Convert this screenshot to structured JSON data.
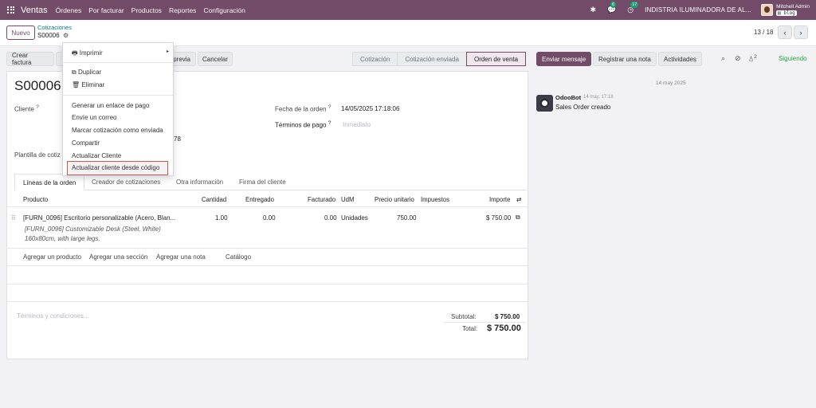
{
  "navbar": {
    "app": "Ventas",
    "menus": [
      "Órdenes",
      "Por facturar",
      "Productos",
      "Reportes",
      "Configuración"
    ],
    "messages_count": "6",
    "activities_count": "17",
    "company": "INDISTRIA ILUMINADORA DE AL...",
    "user": "Mitchell Admin",
    "database": "blog"
  },
  "control": {
    "new_label": "Nuevo",
    "breadcrumb": "Cotizaciones",
    "record": "S00006",
    "pager": "13 / 18"
  },
  "toolbar": {
    "crear_factura": "Crear factura",
    "previa": "previa",
    "cancelar": "Cancelar"
  },
  "statusbar": [
    "Cotización",
    "Cotización enviada",
    "Orden de venta"
  ],
  "dropdown": {
    "imprimir": "Imprimir",
    "duplicar": "Duplicar",
    "eliminar": "Eliminar",
    "items": [
      "Generar un enlace de pago",
      "Envíe un correo",
      "Marcar cotización como enviada",
      "Compartir",
      "Actualizar Cliente",
      "Actualizar cliente desde código"
    ]
  },
  "form": {
    "title": "S00006",
    "cliente_label": "Cliente",
    "partial_value": "78",
    "plantilla_label": "Plantilla de cotiz",
    "fecha_label": "Fecha de la orden",
    "fecha_value": "14/05/2025 17:18:06",
    "terminos_label": "Términos de pago",
    "terminos_placeholder": "Inmediato"
  },
  "tabs": [
    "Líneas de la orden",
    "Creador de cotizaciones",
    "Otra información",
    "Firma del cliente"
  ],
  "columns": [
    "Producto",
    "Cantidad",
    "Entregado",
    "Facturado",
    "UdM",
    "Precio unitario",
    "Impuestos",
    "Importe"
  ],
  "line": {
    "product": "[FURN_0096] Escritorio personalizable (Acero, Blan...",
    "desc1": "[FURN_0096] Customizable Desk (Steel, White)",
    "desc2": "160x80cm, with large legs.",
    "cantidad": "1.00",
    "entregado": "0.00",
    "facturado": "0.00",
    "udm": "Unidades",
    "precio": "750.00",
    "importe": "$ 750.00"
  },
  "add_links": [
    "Agregar un producto",
    "Agregar una sección",
    "Agregar una nota",
    "Catálogo"
  ],
  "terms_placeholder": "Términos y condiciones...",
  "totals": {
    "subtotal_label": "Subtotal:",
    "subtotal": "$ 750.00",
    "total_label": "Total:",
    "total": "$ 750.00"
  },
  "chatter": {
    "send_message": "Enviar mensaje",
    "log_note": "Registrar una nota",
    "activities": "Actividades",
    "followers_count": "2",
    "following": "Siguiendo",
    "date": "14 may 2025",
    "author": "OdooBot",
    "time": "14 may, 17:18",
    "message": "Sales Order creado"
  },
  "colors": {
    "brand": "#714b67",
    "link": "#017e84",
    "highlight_border": "#d9534f",
    "following": "#28a745"
  }
}
